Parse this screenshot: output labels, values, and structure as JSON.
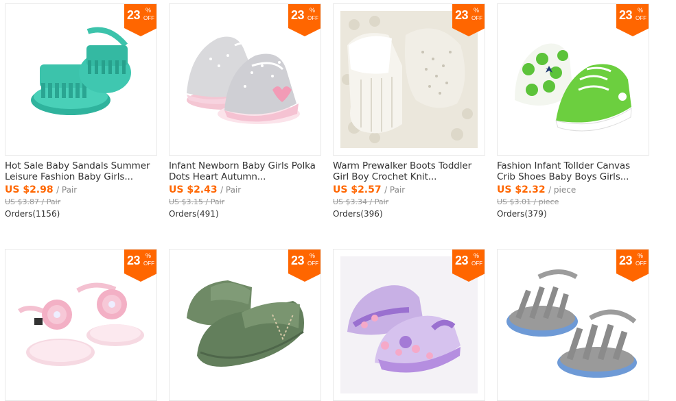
{
  "colors": {
    "accent": "#ff6600",
    "badge": "#ff6600",
    "price": "#ff6600"
  },
  "products": [
    {
      "title": "Hot Sale Baby Sandals Summer Leisure Fashion Baby Girls...",
      "price": "US $2.98",
      "unit": "/ Pair",
      "old_price": "US $3.87 / Pair",
      "orders": "Orders(1156)",
      "discount": "23",
      "discount_pct": "%",
      "discount_off": "OFF",
      "image_icon": "mint-fringe-sandal-icon"
    },
    {
      "title": "Infant Newborn Baby Girls Polka Dots Heart Autumn...",
      "price": "US $2.43",
      "unit": "/ Pair",
      "old_price": "US $3.15 / Pair",
      "orders": "Orders(491)",
      "discount": "23",
      "discount_pct": "%",
      "discount_off": "OFF",
      "image_icon": "pink-polka-sneaker-icon"
    },
    {
      "title": "Warm Prewalker Boots Toddler Girl Boy Crochet Knit...",
      "price": "US $2.57",
      "unit": "/ Pair",
      "old_price": "US $3.34 / Pair",
      "orders": "Orders(396)",
      "discount": "23",
      "discount_pct": "%",
      "discount_off": "OFF",
      "image_icon": "white-knit-boot-icon"
    },
    {
      "title": "Fashion Infant Tollder Canvas Crib Shoes Baby Boys Girls...",
      "price": "US $2.32",
      "unit": "/ piece",
      "old_price": "US $3.01 / piece",
      "orders": "Orders(379)",
      "discount": "23",
      "discount_pct": "%",
      "discount_off": "OFF",
      "image_icon": "green-canvas-sneaker-icon"
    },
    {
      "title": "",
      "price": "",
      "unit": "",
      "old_price": "",
      "orders": "",
      "discount": "23",
      "discount_pct": "%",
      "discount_off": "OFF",
      "image_icon": "pink-flower-sandal-icon"
    },
    {
      "title": "",
      "price": "",
      "unit": "",
      "old_price": "",
      "orders": "",
      "discount": "23",
      "discount_pct": "%",
      "discount_off": "OFF",
      "image_icon": "green-moccasin-icon"
    },
    {
      "title": "",
      "price": "",
      "unit": "",
      "old_price": "",
      "orders": "",
      "discount": "23",
      "discount_pct": "%",
      "discount_off": "OFF",
      "image_icon": "purple-floral-shoe-icon"
    },
    {
      "title": "",
      "price": "",
      "unit": "",
      "old_price": "",
      "orders": "",
      "discount": "23",
      "discount_pct": "%",
      "discount_off": "OFF",
      "image_icon": "gray-blue-sandal-icon"
    }
  ]
}
